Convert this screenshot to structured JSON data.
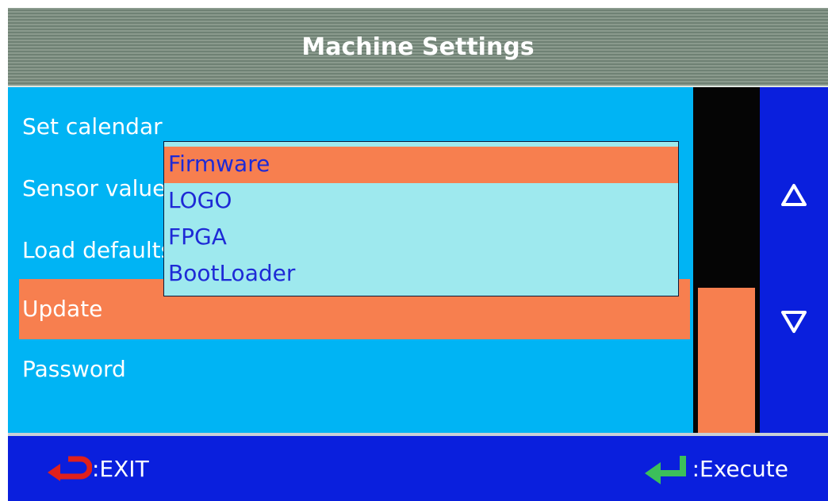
{
  "title": "Machine Settings",
  "menu": {
    "items": [
      {
        "label": "Set calendar"
      },
      {
        "label": "Sensor values"
      },
      {
        "label": "Load defaults"
      },
      {
        "label": "Update"
      },
      {
        "label": "Password"
      }
    ],
    "selected_index": 3
  },
  "dropdown": {
    "options": [
      {
        "label": "Firmware"
      },
      {
        "label": "LOGO"
      },
      {
        "label": "FPGA"
      },
      {
        "label": "BootLoader"
      }
    ],
    "selected_index": 0
  },
  "scroll": {
    "up_icon": "up-arrow-icon",
    "down_icon": "down-arrow-icon"
  },
  "footer": {
    "exit_label": ":EXIT",
    "execute_label": ":Execute"
  },
  "colors": {
    "title_bg": "#7a8c7e",
    "menu_bg": "#00b4f4",
    "highlight": "#f77f4f",
    "dropdown_bg": "#9ee9ee",
    "dropdown_text": "#1e2ad6",
    "footer_bg": "#0a1fdd",
    "exit_icon": "#e0201c",
    "enter_icon": "#3cbf5a"
  }
}
